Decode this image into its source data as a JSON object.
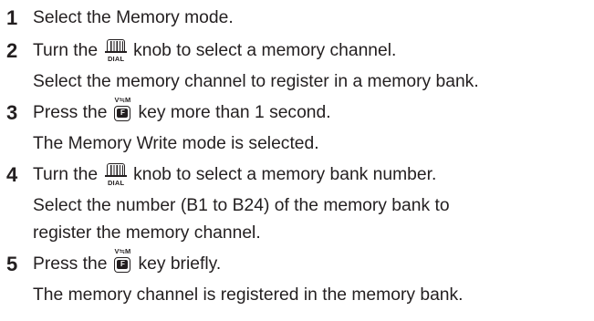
{
  "steps": [
    {
      "number": "1",
      "action": {
        "pre": "Select the Memory mode.",
        "icon": "",
        "post": ""
      },
      "details": []
    },
    {
      "number": "2",
      "action": {
        "pre": "Turn the",
        "icon": "dial-knob-icon",
        "post": "knob to select a memory channel."
      },
      "details": [
        "Select the memory channel to register in a memory bank."
      ]
    },
    {
      "number": "3",
      "action": {
        "pre": "Press the",
        "icon": "f-key-icon",
        "post": "key more than 1 second."
      },
      "details": [
        "The Memory Write mode is selected."
      ]
    },
    {
      "number": "4",
      "action": {
        "pre": "Turn the",
        "icon": "dial-knob-icon",
        "post": "knob to select a memory bank number."
      },
      "details": [
        "Select the number (B1 to B24) of the memory bank to",
        "register the memory channel."
      ]
    },
    {
      "number": "5",
      "action": {
        "pre": "Press the",
        "icon": "f-key-icon",
        "post": "key briefly."
      },
      "details": [
        "The memory channel is registered in the memory bank."
      ]
    }
  ],
  "icons": {
    "dial_caption": "DIAL",
    "fkey_sub_label": "V≒M",
    "fkey_face_label": "F"
  }
}
